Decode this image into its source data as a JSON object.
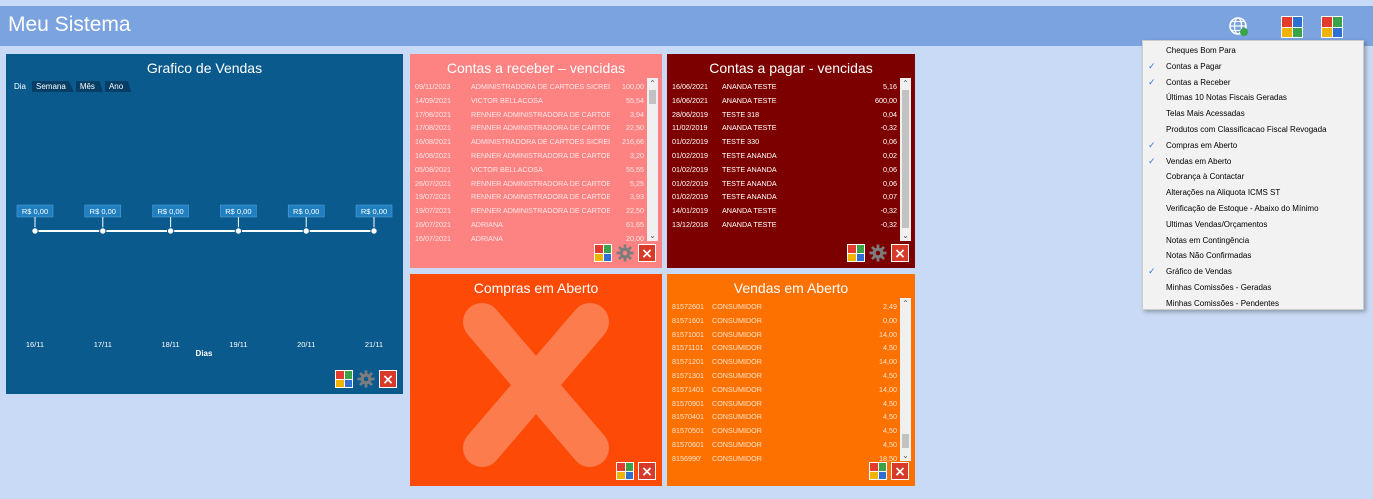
{
  "app": {
    "title": "Meu Sistema"
  },
  "toolbar": {
    "icons": [
      "globe-icon",
      "tiles-check-icon",
      "tiles-icon"
    ]
  },
  "colors": {
    "titlebar": "#7aa3df",
    "chart_tile": "#0a5a8e",
    "receber": "#fd8383",
    "pagar": "#7c0000",
    "compras": "#fd4a06",
    "vendas": "#fd7100"
  },
  "chart": {
    "title": "Grafico de Vendas",
    "range_tabs": [
      "Dia",
      "Semana",
      "Mês",
      "Ano"
    ],
    "chart_data": {
      "type": "line",
      "title": "Grafico de Vendas",
      "xlabel": "Dias",
      "ylabel": "",
      "categories": [
        "16/11",
        "17/11",
        "18/11",
        "19/11",
        "20/11",
        "21/11"
      ],
      "values": [
        0,
        0,
        0,
        0,
        0,
        0
      ],
      "data_labels": [
        "R$ 0,00",
        "R$ 0,00",
        "R$ 0,00",
        "R$ 0,00",
        "R$ 0,00",
        "R$ 0,00"
      ],
      "grid": false
    }
  },
  "receber": {
    "title": "Contas a receber – vencidas",
    "rows": [
      [
        "09/11/2023",
        "ADMINISTRADORA DE CARTOES SICREDI",
        "100,00"
      ],
      [
        "14/09/2021",
        "VICTOR BELLACOSA",
        "55,54"
      ],
      [
        "17/08/2021",
        "RENNER ADMINISTRADORA DE CARTOES",
        "3,94"
      ],
      [
        "17/08/2021",
        "RENNER ADMINISTRADORA DE CARTOES",
        "22,50"
      ],
      [
        "16/08/2021",
        "ADMINISTRADORA DE CARTOES SICREDI",
        "216,66"
      ],
      [
        "16/08/2021",
        "RENNER ADMINISTRADORA DE CARTOES",
        "3,20"
      ],
      [
        "05/08/2021",
        "VICTOR BELLACOSA",
        "55,55"
      ],
      [
        "26/07/2021",
        "RENNER ADMINISTRADORA DE CARTOES",
        "5,25"
      ],
      [
        "19/07/2021",
        "RENNER ADMINISTRADORA DE CARTOES",
        "3,93"
      ],
      [
        "19/07/2021",
        "RENNER ADMINISTRADORA DE CARTOES",
        "22,50"
      ],
      [
        "16/07/2021",
        "ADRIANA",
        "61,65"
      ],
      [
        "16/07/2021",
        "ADRIANA",
        "20,00"
      ]
    ]
  },
  "pagar": {
    "title": "Contas a pagar - vencidas",
    "rows": [
      [
        "16/06/2021",
        "ANANDA TESTE",
        "5,16"
      ],
      [
        "16/06/2021",
        "ANANDA TESTE",
        "600,00"
      ],
      [
        "28/06/2019",
        "TESTE 318",
        "0,04"
      ],
      [
        "11/02/2019",
        "ANANDA TESTE",
        "-0,32"
      ],
      [
        "01/02/2019",
        "TESTE 330",
        "0,06"
      ],
      [
        "01/02/2019",
        "TESTE ANANDA",
        "0,02"
      ],
      [
        "01/02/2019",
        "TESTE ANANDA",
        "0,06"
      ],
      [
        "01/02/2019",
        "TESTE ANANDA",
        "0,06"
      ],
      [
        "01/02/2019",
        "TESTE ANANDA",
        "0,07"
      ],
      [
        "14/01/2019",
        "ANANDA TESTE",
        "-0,32"
      ],
      [
        "13/12/2018",
        "ANANDA TESTE",
        "-0,32"
      ]
    ]
  },
  "compras": {
    "title": "Compras em Aberto"
  },
  "vendas": {
    "title": "Vendas em Aberto",
    "rows": [
      [
        "81572601",
        "CONSUMIDOR",
        "2,49"
      ],
      [
        "81571601",
        "CONSUMIDOR",
        "0,00"
      ],
      [
        "81571001",
        "CONSUMIDOR",
        "14,00"
      ],
      [
        "81571101",
        "CONSUMIDOR",
        "4,50"
      ],
      [
        "81571201",
        "CONSUMIDOR",
        "14,00"
      ],
      [
        "81571301",
        "CONSUMIDOR",
        "4,50"
      ],
      [
        "81571401",
        "CONSUMIDOR",
        "14,00"
      ],
      [
        "81570901",
        "CONSUMIDOR",
        "4,50"
      ],
      [
        "81570401",
        "CONSUMIDOR",
        "4,50"
      ],
      [
        "81570501",
        "CONSUMIDOR",
        "4,50"
      ],
      [
        "81570601",
        "CONSUMIDOR",
        "4,50"
      ],
      [
        "8156990'",
        "CONSUMIDOR",
        "18,50"
      ]
    ]
  },
  "menu": {
    "items": [
      {
        "label": "Cheques Bom Para",
        "checked": false
      },
      {
        "label": "Contas a Pagar",
        "checked": true
      },
      {
        "label": "Contas a Receber",
        "checked": true
      },
      {
        "label": "Últimas 10 Notas Fiscais Geradas",
        "checked": false
      },
      {
        "label": "Telas Mais Acessadas",
        "checked": false
      },
      {
        "label": "Produtos com Classificacao Fiscal Revogada",
        "checked": false
      },
      {
        "label": "Compras em Aberto",
        "checked": true
      },
      {
        "label": "Vendas em Aberto",
        "checked": true
      },
      {
        "label": "Cobrança à Contactar",
        "checked": false
      },
      {
        "label": "Alterações na Aliquota ICMS ST",
        "checked": false
      },
      {
        "label": "Verificação de Estoque - Abaixo do Mínimo",
        "checked": false
      },
      {
        "label": "Ultimas Vendas/Orçamentos",
        "checked": false
      },
      {
        "label": "Notas em Contingência",
        "checked": false
      },
      {
        "label": "Notas Não Confirmadas",
        "checked": false
      },
      {
        "label": "Gráfico de Vendas",
        "checked": true
      },
      {
        "label": "Minhas Comissões - Geradas",
        "checked": false
      },
      {
        "label": "Minhas Comissões - Pendentes",
        "checked": false
      }
    ]
  }
}
